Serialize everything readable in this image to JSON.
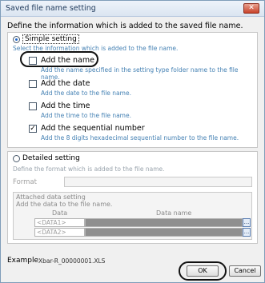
{
  "window": {
    "title": "Saved file name setting",
    "close_glyph": "✕"
  },
  "intro": "Define the information which is added to the saved file name.",
  "simple": {
    "label": "Simple setting",
    "selected": true,
    "hint": "Select the information which is added to the file name.",
    "options": [
      {
        "label": "Add the name",
        "checked": false,
        "desc": "Add the name specified in the setting type folder name to the file name."
      },
      {
        "label": "Add the date",
        "checked": false,
        "desc": "Add the date to the file name."
      },
      {
        "label": "Add the time",
        "checked": false,
        "desc": "Add the time to the file name."
      },
      {
        "label": "Add the sequential number",
        "checked": true,
        "desc": "Add the 8 digits hexadecimal sequential number to the file name."
      }
    ]
  },
  "detailed": {
    "label": "Detailed setting",
    "selected": false,
    "hint": "Define the format which is added to the file name.",
    "format_label": "Format",
    "format_value": "",
    "attached_title": "Attached data setting",
    "attached_hint": "Add the data to the file name.",
    "columns": [
      "Data",
      "Data name"
    ],
    "rows": [
      {
        "data": "<DATA1>",
        "name": ""
      },
      {
        "data": "<DATA2>",
        "name": ""
      }
    ],
    "browse_glyph": "..."
  },
  "example": {
    "label": "Example",
    "value": "Xbar-R_00000001.XLS"
  },
  "buttons": {
    "ok": "OK",
    "cancel": "Cancel"
  },
  "colors": {
    "hint_blue": "#4682b4",
    "accent": "#1b64c8"
  }
}
